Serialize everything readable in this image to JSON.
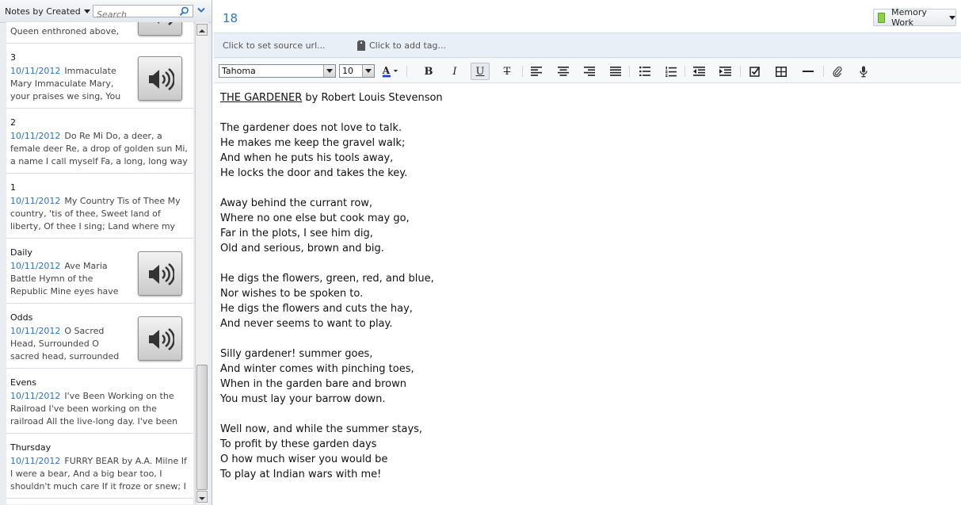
{
  "sidebar": {
    "sort_label": "Notes by Created",
    "search_placeholder": "Search",
    "notes": [
      {
        "title": "",
        "date": "",
        "snippet_tail": "Queen enthroned above, ...",
        "has_audio": true
      },
      {
        "title": "3",
        "date": "10/11/2012",
        "snippet": "Immaculate Mary Immaculate Mary, your praises we sing, You reign ...",
        "has_audio": true
      },
      {
        "title": "2",
        "date": "10/11/2012",
        "snippet": "Do Re Mi Do, a deer, a female deer Re, a drop of golden sun Mi, a name I call myself Fa, a long, long way to run Sol, ...",
        "has_audio": false
      },
      {
        "title": "1",
        "date": "10/11/2012",
        "snippet": "My Country Tis of Thee My country, 'tis of thee, Sweet land of liberty, Of thee I sing; Land where my fathers died, La...",
        "has_audio": false
      },
      {
        "title": "Daily",
        "date": "10/11/2012",
        "snippet": "Ave Maria Battle Hymn of the Republic Mine eyes have seen the glory ...",
        "has_audio": true
      },
      {
        "title": "Odds",
        "date": "10/11/2012",
        "snippet": "O Sacred Head, Surrounded O sacred head, surrounded by crown of pi...",
        "has_audio": true
      },
      {
        "title": "Evens",
        "date": "10/11/2012",
        "snippet": "I've Been Working on the Railroad I've been working on the railroad All the live-long day. I've been working on the ...",
        "has_audio": false
      },
      {
        "title": "Thursday",
        "date": "10/11/2012",
        "snippet": "FURRY BEAR by A.A. Milne If I were a bear, And a big bear too, I shouldn't much care If it froze or snew; I shouldn't m...",
        "has_audio": false
      }
    ]
  },
  "note": {
    "title": "18",
    "notebook": "Memory Work",
    "source_url_prompt": "Click to set source url...",
    "tag_prompt": "Click to add tag...",
    "font": "Tahoma",
    "font_size": "10",
    "heading_title": "THE GARDENER",
    "heading_author": " by Robert Louis Stevenson",
    "stanzas": [
      [
        "The gardener does not love to talk.",
        "He makes me keep the gravel walk;",
        "And when he puts his tools away,",
        "He locks the door and takes the key."
      ],
      [
        "Away behind the currant row,",
        "Where no one else but cook may go,",
        "Far in the plots, I see him dig,",
        "Old and serious, brown and big."
      ],
      [
        "He digs the flowers, green, red, and blue,",
        "Nor wishes to be spoken to.",
        "He digs the flowers and cuts the hay,",
        "And never seems to want to play."
      ],
      [
        "Silly gardener! summer goes,",
        "And winter comes with pinching toes,",
        "When in the garden bare and brown",
        "You must lay your barrow down."
      ],
      [
        "Well now, and while the summer stays,",
        "To profit by these garden days",
        "O how much wiser you would be",
        "To play at Indian wars with me!"
      ]
    ]
  },
  "toolbar": {
    "bold": "B",
    "italic": "I",
    "underline": "U",
    "strike": "T",
    "font_color": "A"
  },
  "colors": {
    "accent": "#2e74c2",
    "font_color_bar": "#1f3fd8"
  }
}
